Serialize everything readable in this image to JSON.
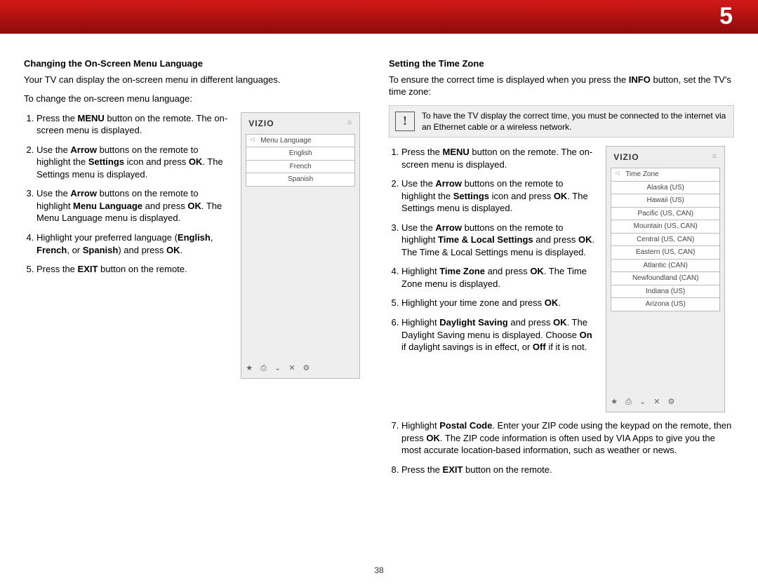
{
  "chapter_num": "5",
  "page_num": "38",
  "left": {
    "heading": "Changing the On-Screen Menu Language",
    "intro1": "Your TV can display the on-screen menu in different languages.",
    "intro2": "To change the on-screen menu language:",
    "steps": {
      "s1a": "Press the ",
      "s1b": "MENU",
      "s1c": " button on the remote. The on-screen menu is displayed.",
      "s2a": "Use the ",
      "s2b": "Arrow",
      "s2c": " buttons on the remote to highlight the ",
      "s2d": "Settings",
      "s2e": " icon and press ",
      "s2f": "OK",
      "s2g": ". The Settings menu is displayed.",
      "s3a": "Use the ",
      "s3b": "Arrow",
      "s3c": " buttons on the remote to highlight ",
      "s3d": "Menu Language",
      "s3e": " and press ",
      "s3f": "OK",
      "s3g": ". The Menu Language menu is displayed.",
      "s4a": "Highlight your preferred language (",
      "s4b": "English",
      "s4c": ", ",
      "s4d": "French",
      "s4e": ", or ",
      "s4f": "Spanish",
      "s4g": ") and press ",
      "s4h": "OK",
      "s4i": ".",
      "s5a": "Press the ",
      "s5b": "EXIT",
      "s5c": " button on the remote."
    },
    "tv": {
      "logo": "VIZIO",
      "header": "Menu Language",
      "items": [
        "English",
        "French",
        "Spanish"
      ]
    }
  },
  "right": {
    "heading": "Setting the Time Zone",
    "intro_a": "To ensure the correct time is displayed when you press the ",
    "intro_b": "INFO",
    "intro_c": " button, set the TV's time zone:",
    "note": "To have the TV display the correct time, you must be connected to the internet via an Ethernet cable or a wireless network.",
    "steps": {
      "s1a": "Press the ",
      "s1b": "MENU",
      "s1c": " button on the remote. The on-screen menu is displayed.",
      "s2a": "Use the ",
      "s2b": "Arrow",
      "s2c": " buttons on the remote to highlight the ",
      "s2d": "Settings",
      "s2e": " icon and press ",
      "s2f": "OK",
      "s2g": ". The Settings menu is displayed.",
      "s3a": "Use the ",
      "s3b": "Arrow",
      "s3c": " buttons on the remote to highlight ",
      "s3d": "Time & Local Settings",
      "s3e": " and press ",
      "s3f": "OK",
      "s3g": ". The Time & Local Settings menu is displayed.",
      "s4a": "Highlight ",
      "s4b": "Time Zone",
      "s4c": " and press ",
      "s4d": "OK",
      "s4e": ". The Time Zone menu is displayed.",
      "s5a": "Highlight your time zone and press ",
      "s5b": "OK",
      "s5c": ".",
      "s6a": "Highlight ",
      "s6b": "Daylight Saving",
      "s6c": " and press ",
      "s6d": "OK",
      "s6e": ". The Daylight Saving menu is displayed. Choose ",
      "s6f": "On",
      "s6g": " if daylight savings is in effect, or ",
      "s6h": "Off",
      "s6i": " if it is not.",
      "s7a": "Highlight ",
      "s7b": "Postal Code",
      "s7c": ". Enter your ZIP code using the keypad on the remote, then press ",
      "s7d": "OK",
      "s7e": ". The ZIP code information is often used by VIA Apps to give you the most accurate location-based information, such as weather or news.",
      "s8a": "Press the ",
      "s8b": "EXIT",
      "s8c": " button on the remote."
    },
    "tv": {
      "logo": "VIZIO",
      "header": "Time Zone",
      "items": [
        "Alaska (US)",
        "Hawaii (US)",
        "Pacific (US, CAN)",
        "Mountain (US, CAN)",
        "Central (US, CAN)",
        "Eastern (US, CAN)",
        "Atlantic (CAN)",
        "Newfoundland (CAN)",
        "Indiana (US)",
        "Arizona (US)"
      ]
    }
  },
  "icons": {
    "bottom": "★ ⎙ ⌄ ✕ ⚙"
  }
}
